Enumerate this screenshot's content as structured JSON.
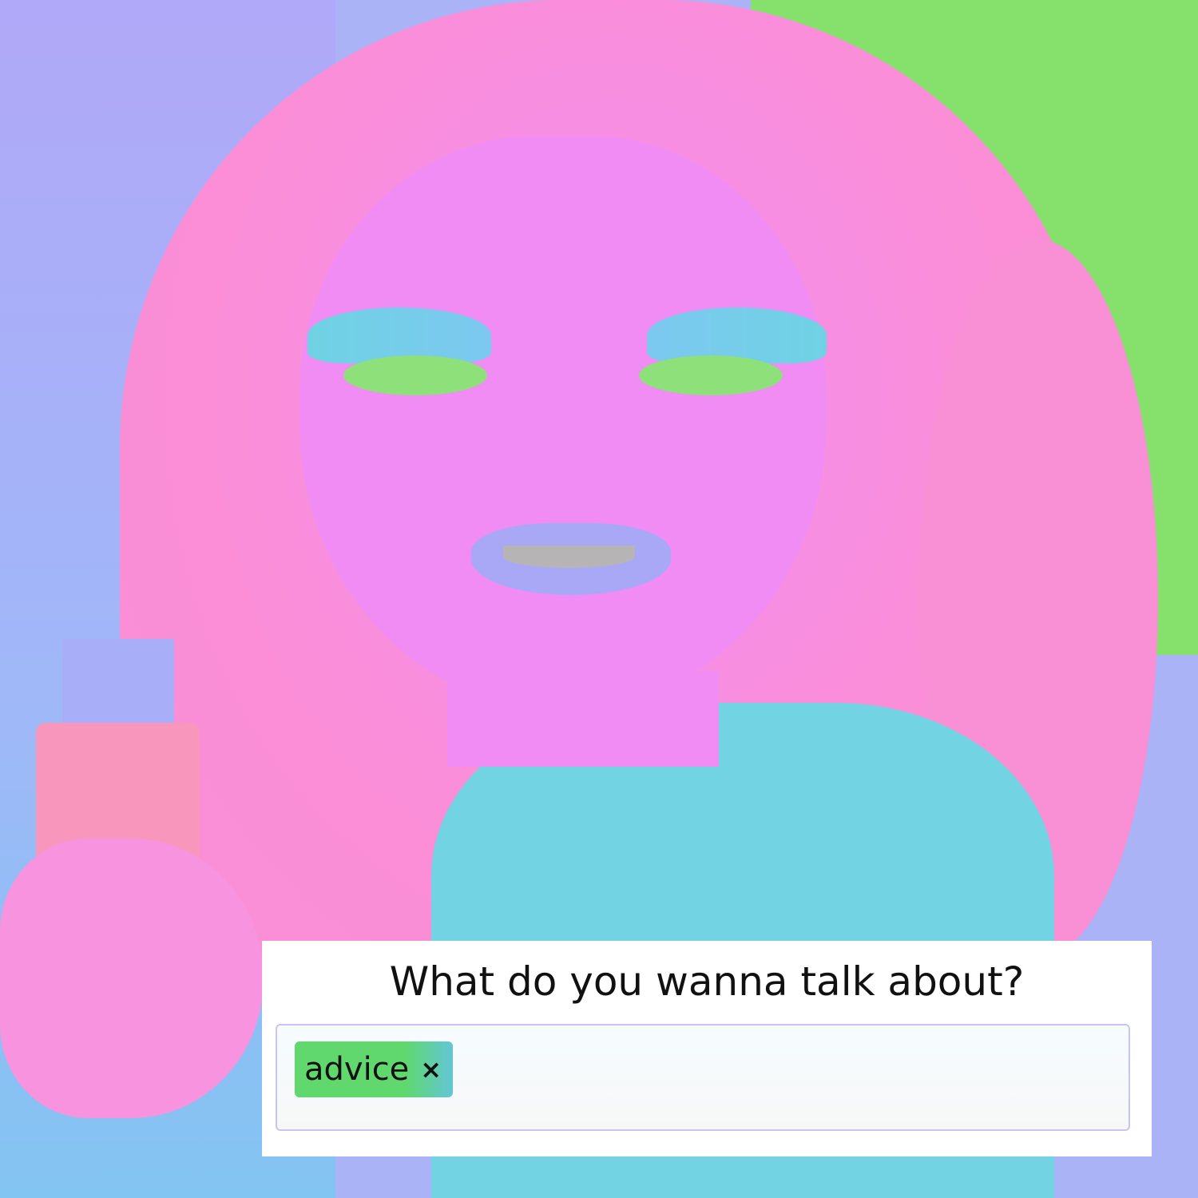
{
  "prompt": {
    "title": "What do you wanna talk about?"
  },
  "tags": [
    {
      "label": "advice",
      "remove_icon": "×"
    }
  ],
  "colors": {
    "chip": "#60d86e",
    "panel": "#ffffff"
  }
}
